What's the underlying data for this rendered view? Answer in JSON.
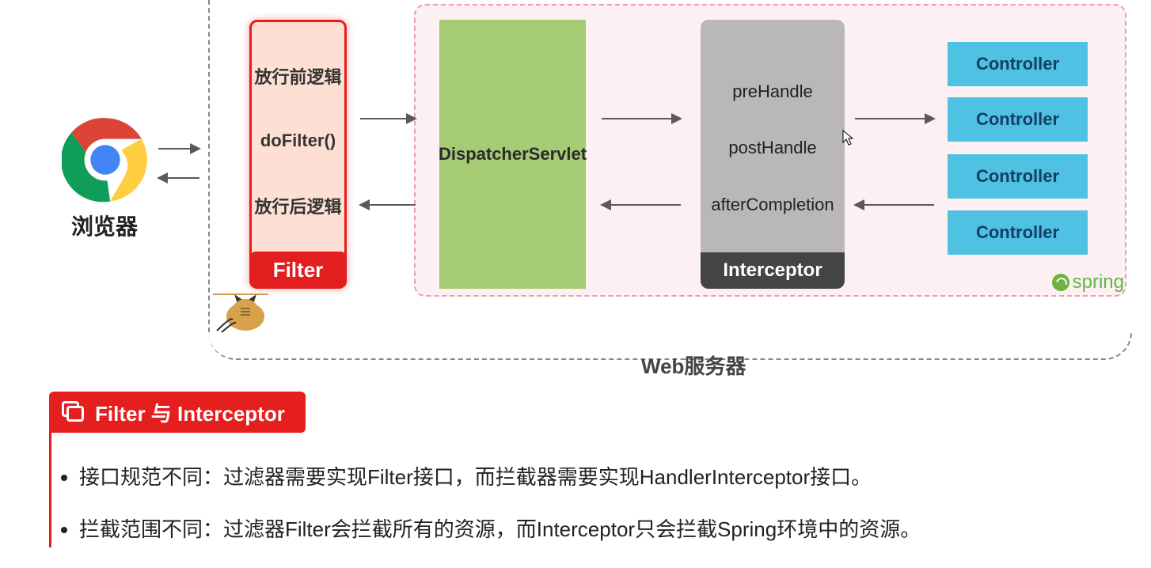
{
  "diagram": {
    "browser_label": "浏览器",
    "filter": {
      "before": "放行前逻辑",
      "method": "doFilter()",
      "after": "放行后逻辑",
      "label": "Filter"
    },
    "dispatcher": "DispatcherServlet",
    "interceptor": {
      "m1": "preHandle",
      "m2": "postHandle",
      "m3": "afterCompletion",
      "label": "Interceptor"
    },
    "controllers": {
      "c1": "Controller",
      "c2": "Controller",
      "c3": "Controller",
      "c4": "Controller"
    },
    "spring_label": "spring",
    "web_label": "Web服务器"
  },
  "section": {
    "title": "Filter 与 Interceptor",
    "bullets": {
      "b1": "接口规范不同：过滤器需要实现Filter接口，而拦截器需要实现HandlerInterceptor接口。",
      "b2": "拦截范围不同：过滤器Filter会拦截所有的资源，而Interceptor只会拦截Spring环境中的资源。"
    }
  },
  "colors": {
    "accent_red": "#e31e1e",
    "green_block": "#a5cb74",
    "grey_block": "#b9b8b6",
    "blue_block": "#4fc1e3",
    "spring_green": "#6db33f"
  }
}
